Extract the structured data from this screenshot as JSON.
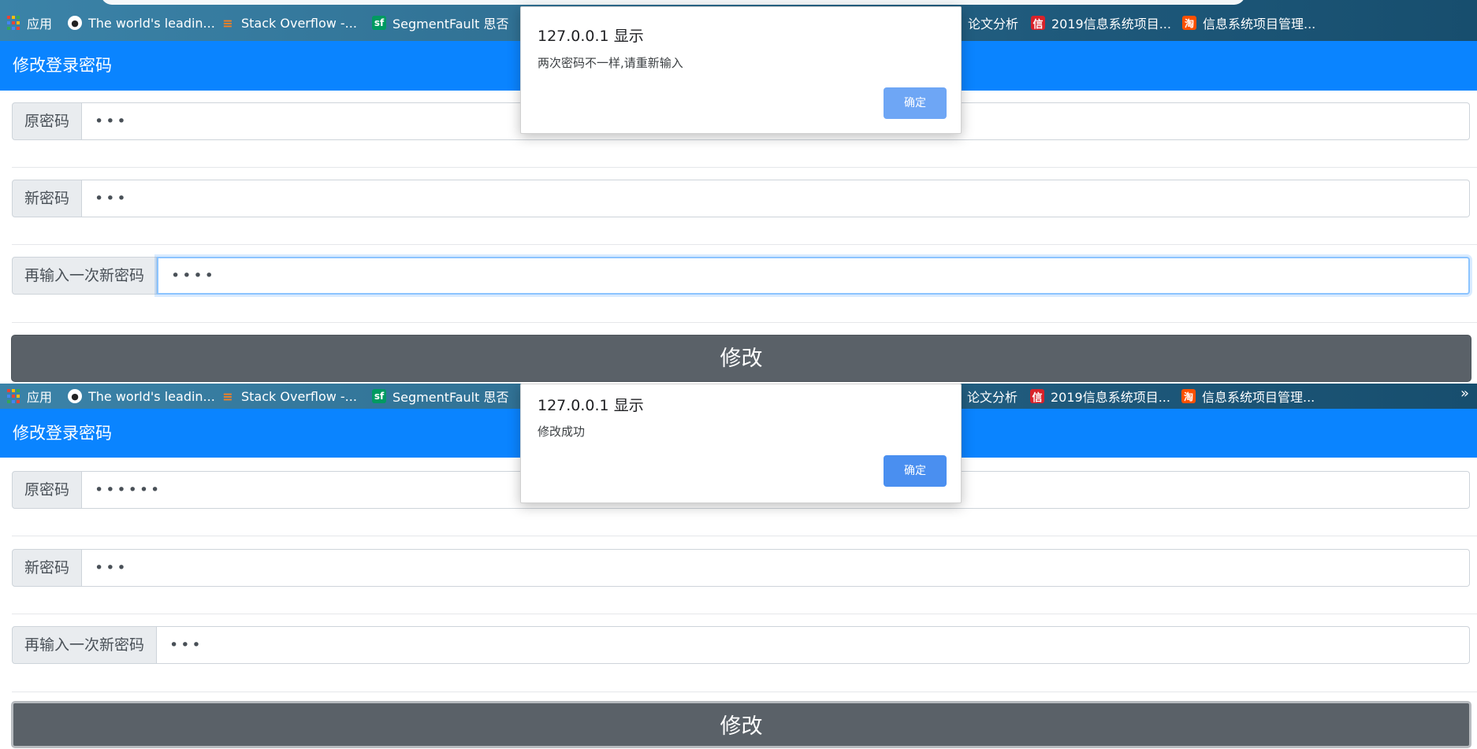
{
  "bookmarks": [
    {
      "label": "应用",
      "icon": "apps-grid-icon"
    },
    {
      "label": "The world's leadin...",
      "icon": "github-icon"
    },
    {
      "label": "Stack Overflow -...",
      "icon": "stackoverflow-icon"
    },
    {
      "label": "SegmentFault 思否",
      "icon": "segmentfault-icon",
      "icon_text": "sf"
    },
    {
      "label": "论文分析",
      "icon": ""
    },
    {
      "label": "2019信息系统项目...",
      "icon": "xin-icon",
      "icon_text": "信"
    },
    {
      "label": "信息系统项目管理...",
      "icon": "taobao-icon",
      "icon_text": "淘"
    }
  ],
  "bookmarks_more": "»",
  "page_title": "修改登录密码",
  "labels": {
    "old_password": "原密码",
    "new_password": "新密码",
    "confirm_password": "再输入一次新密码"
  },
  "submit_label": "修改",
  "screens": [
    {
      "fields": {
        "old_password": "•••",
        "new_password": "•••",
        "confirm_password": "••••"
      },
      "dialog": {
        "title": "127.0.0.1 显示",
        "message": "两次密码不一样,请重新输入",
        "ok": "确定"
      }
    },
    {
      "fields": {
        "old_password": "••••••",
        "new_password": "•••",
        "confirm_password": "•••"
      },
      "dialog": {
        "title": "127.0.0.1 显示",
        "message": "修改成功",
        "ok": "确定"
      }
    }
  ],
  "colors": {
    "header": "#0a84ff",
    "submit": "#5a6168",
    "dialog_button": "#5a9cf8"
  }
}
